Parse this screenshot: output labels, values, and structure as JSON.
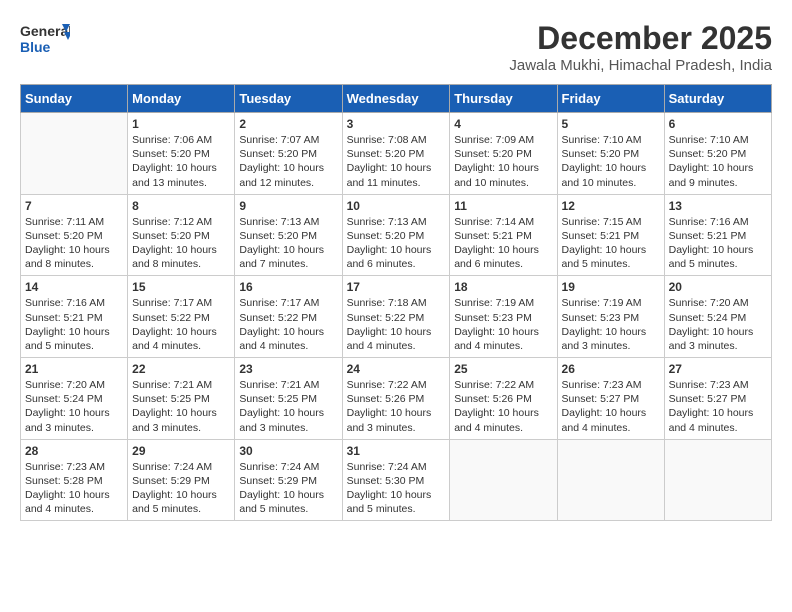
{
  "header": {
    "logo_general": "General",
    "logo_blue": "Blue",
    "month_title": "December 2025",
    "location": "Jawala Mukhi, Himachal Pradesh, India"
  },
  "columns": [
    "Sunday",
    "Monday",
    "Tuesday",
    "Wednesday",
    "Thursday",
    "Friday",
    "Saturday"
  ],
  "weeks": [
    [
      {
        "day": "",
        "info": ""
      },
      {
        "day": "1",
        "info": "Sunrise: 7:06 AM\nSunset: 5:20 PM\nDaylight: 10 hours\nand 13 minutes."
      },
      {
        "day": "2",
        "info": "Sunrise: 7:07 AM\nSunset: 5:20 PM\nDaylight: 10 hours\nand 12 minutes."
      },
      {
        "day": "3",
        "info": "Sunrise: 7:08 AM\nSunset: 5:20 PM\nDaylight: 10 hours\nand 11 minutes."
      },
      {
        "day": "4",
        "info": "Sunrise: 7:09 AM\nSunset: 5:20 PM\nDaylight: 10 hours\nand 10 minutes."
      },
      {
        "day": "5",
        "info": "Sunrise: 7:10 AM\nSunset: 5:20 PM\nDaylight: 10 hours\nand 10 minutes."
      },
      {
        "day": "6",
        "info": "Sunrise: 7:10 AM\nSunset: 5:20 PM\nDaylight: 10 hours\nand 9 minutes."
      }
    ],
    [
      {
        "day": "7",
        "info": "Sunrise: 7:11 AM\nSunset: 5:20 PM\nDaylight: 10 hours\nand 8 minutes."
      },
      {
        "day": "8",
        "info": "Sunrise: 7:12 AM\nSunset: 5:20 PM\nDaylight: 10 hours\nand 8 minutes."
      },
      {
        "day": "9",
        "info": "Sunrise: 7:13 AM\nSunset: 5:20 PM\nDaylight: 10 hours\nand 7 minutes."
      },
      {
        "day": "10",
        "info": "Sunrise: 7:13 AM\nSunset: 5:20 PM\nDaylight: 10 hours\nand 6 minutes."
      },
      {
        "day": "11",
        "info": "Sunrise: 7:14 AM\nSunset: 5:21 PM\nDaylight: 10 hours\nand 6 minutes."
      },
      {
        "day": "12",
        "info": "Sunrise: 7:15 AM\nSunset: 5:21 PM\nDaylight: 10 hours\nand 5 minutes."
      },
      {
        "day": "13",
        "info": "Sunrise: 7:16 AM\nSunset: 5:21 PM\nDaylight: 10 hours\nand 5 minutes."
      }
    ],
    [
      {
        "day": "14",
        "info": "Sunrise: 7:16 AM\nSunset: 5:21 PM\nDaylight: 10 hours\nand 5 minutes."
      },
      {
        "day": "15",
        "info": "Sunrise: 7:17 AM\nSunset: 5:22 PM\nDaylight: 10 hours\nand 4 minutes."
      },
      {
        "day": "16",
        "info": "Sunrise: 7:17 AM\nSunset: 5:22 PM\nDaylight: 10 hours\nand 4 minutes."
      },
      {
        "day": "17",
        "info": "Sunrise: 7:18 AM\nSunset: 5:22 PM\nDaylight: 10 hours\nand 4 minutes."
      },
      {
        "day": "18",
        "info": "Sunrise: 7:19 AM\nSunset: 5:23 PM\nDaylight: 10 hours\nand 4 minutes."
      },
      {
        "day": "19",
        "info": "Sunrise: 7:19 AM\nSunset: 5:23 PM\nDaylight: 10 hours\nand 3 minutes."
      },
      {
        "day": "20",
        "info": "Sunrise: 7:20 AM\nSunset: 5:24 PM\nDaylight: 10 hours\nand 3 minutes."
      }
    ],
    [
      {
        "day": "21",
        "info": "Sunrise: 7:20 AM\nSunset: 5:24 PM\nDaylight: 10 hours\nand 3 minutes."
      },
      {
        "day": "22",
        "info": "Sunrise: 7:21 AM\nSunset: 5:25 PM\nDaylight: 10 hours\nand 3 minutes."
      },
      {
        "day": "23",
        "info": "Sunrise: 7:21 AM\nSunset: 5:25 PM\nDaylight: 10 hours\nand 3 minutes."
      },
      {
        "day": "24",
        "info": "Sunrise: 7:22 AM\nSunset: 5:26 PM\nDaylight: 10 hours\nand 3 minutes."
      },
      {
        "day": "25",
        "info": "Sunrise: 7:22 AM\nSunset: 5:26 PM\nDaylight: 10 hours\nand 4 minutes."
      },
      {
        "day": "26",
        "info": "Sunrise: 7:23 AM\nSunset: 5:27 PM\nDaylight: 10 hours\nand 4 minutes."
      },
      {
        "day": "27",
        "info": "Sunrise: 7:23 AM\nSunset: 5:27 PM\nDaylight: 10 hours\nand 4 minutes."
      }
    ],
    [
      {
        "day": "28",
        "info": "Sunrise: 7:23 AM\nSunset: 5:28 PM\nDaylight: 10 hours\nand 4 minutes."
      },
      {
        "day": "29",
        "info": "Sunrise: 7:24 AM\nSunset: 5:29 PM\nDaylight: 10 hours\nand 5 minutes."
      },
      {
        "day": "30",
        "info": "Sunrise: 7:24 AM\nSunset: 5:29 PM\nDaylight: 10 hours\nand 5 minutes."
      },
      {
        "day": "31",
        "info": "Sunrise: 7:24 AM\nSunset: 5:30 PM\nDaylight: 10 hours\nand 5 minutes."
      },
      {
        "day": "",
        "info": ""
      },
      {
        "day": "",
        "info": ""
      },
      {
        "day": "",
        "info": ""
      }
    ]
  ]
}
